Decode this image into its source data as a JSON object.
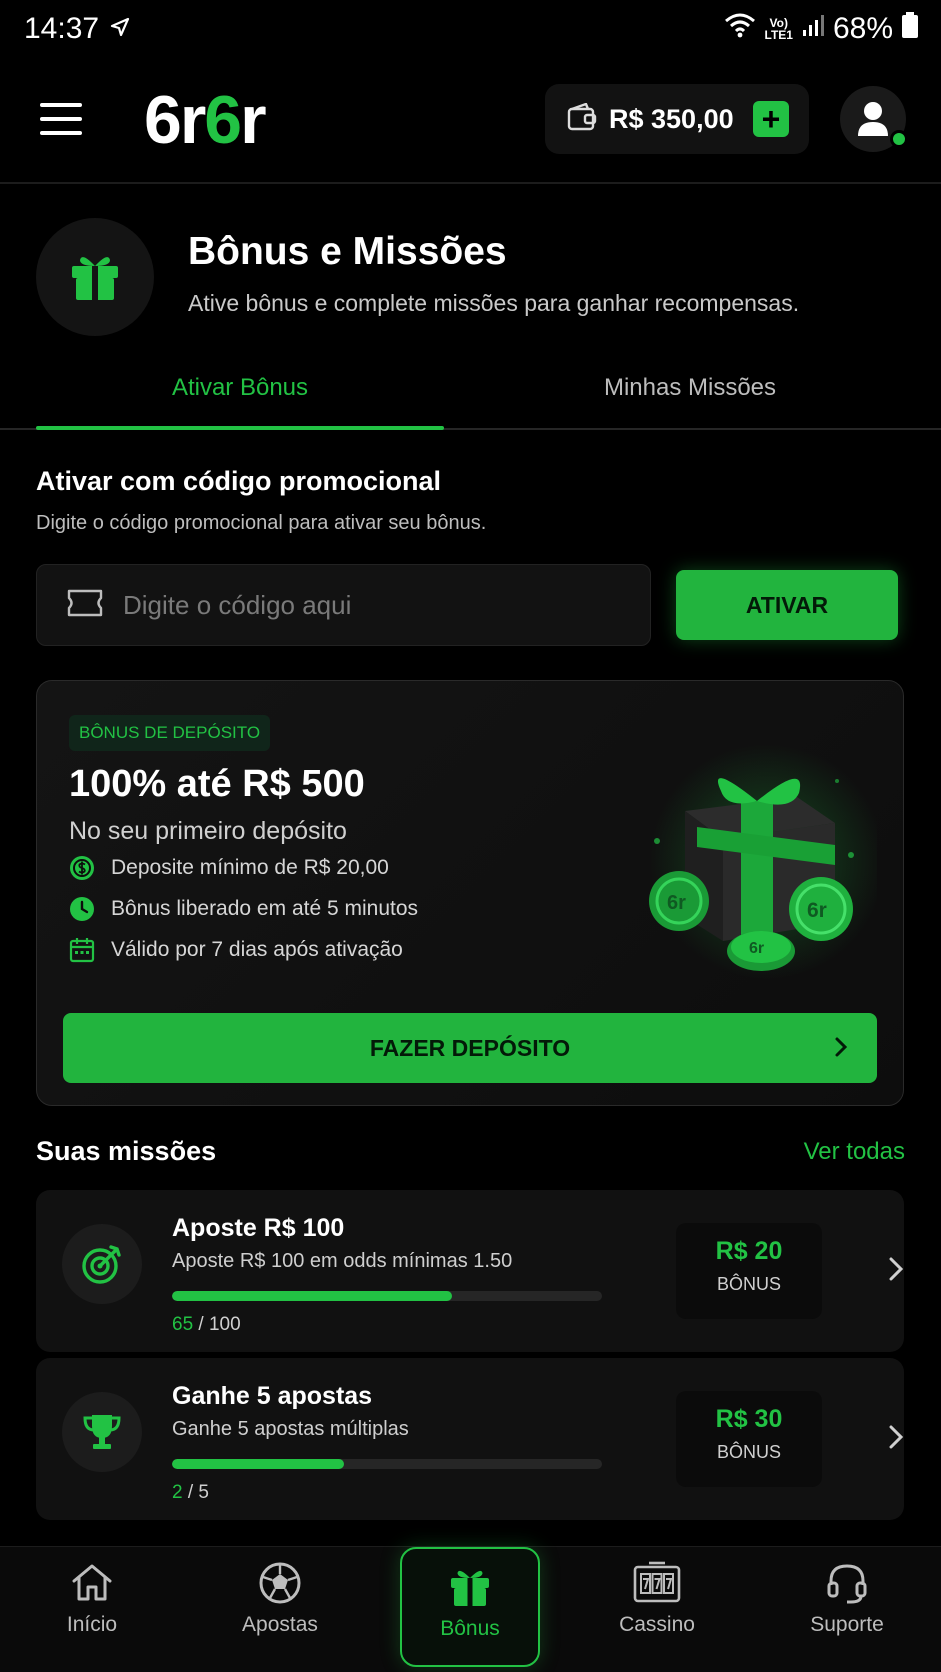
{
  "status_bar": {
    "time": "14:37",
    "volte_top": "Vo)",
    "volte_bottom": "LTE1",
    "battery": "68%"
  },
  "header": {
    "logo_parts": [
      "6r",
      "6",
      "r"
    ],
    "wallet_amount": "R$ 350,00",
    "add_symbol": "+"
  },
  "page": {
    "title": "Bônus e Missões",
    "subtitle": "Ative bônus e complete missões para ganhar recompensas."
  },
  "tabs": [
    {
      "label": "Ativar Bônus",
      "active": true
    },
    {
      "label": "Minhas Missões",
      "active": false
    }
  ],
  "promo": {
    "title": "Ativar com código promocional",
    "description": "Digite o código promocional para ativar seu bônus.",
    "input_placeholder": "Digite o código aqui",
    "input_value": "",
    "button_label": "ATIVAR"
  },
  "bonus_card": {
    "badge": "BÔNUS DE DEPÓSITO",
    "headline": "100% até R$ 500",
    "subtitle": "No seu primeiro depósito",
    "features": [
      {
        "icon": "dollar-icon",
        "text": "Deposite mínimo de R$ 20,00"
      },
      {
        "icon": "clock-icon",
        "text": "Bônus liberado em até 5 minutos"
      },
      {
        "icon": "calendar-icon",
        "text": "Válido por 7 dias após ativação"
      }
    ],
    "coin_label": "6r",
    "button_label": "FAZER DEPÓSITO"
  },
  "missions": {
    "title": "Suas missões",
    "see_all": "Ver todas",
    "items": [
      {
        "icon": "target-icon",
        "title": "Aposte R$ 100",
        "description": "Aposte R$ 100 em odds mínimas 1.50",
        "progress_current": "65",
        "progress_total": "/ 100",
        "progress_fraction": 0.65,
        "reward_amount": "R$ 20",
        "reward_label": "BÔNUS"
      },
      {
        "icon": "trophy-icon",
        "title": "Ganhe 5 apostas",
        "description": "Ganhe 5 apostas múltiplas",
        "progress_current": "2",
        "progress_total": "/ 5",
        "progress_fraction": 0.4,
        "reward_amount": "R$ 30",
        "reward_label": "BÔNUS"
      }
    ]
  },
  "bottom_nav": [
    {
      "label": "Início",
      "icon": "home-icon",
      "active": false
    },
    {
      "label": "Apostas",
      "icon": "soccer-ball-icon",
      "active": false
    },
    {
      "label": "Bônus",
      "icon": "gift-icon",
      "active": true
    },
    {
      "label": "Cassino",
      "icon": "slot-machine-icon",
      "active": false
    },
    {
      "label": "Suporte",
      "icon": "headset-icon",
      "active": false
    }
  ],
  "colors": {
    "accent": "#22c244",
    "background": "#000000",
    "card": "#111111"
  }
}
